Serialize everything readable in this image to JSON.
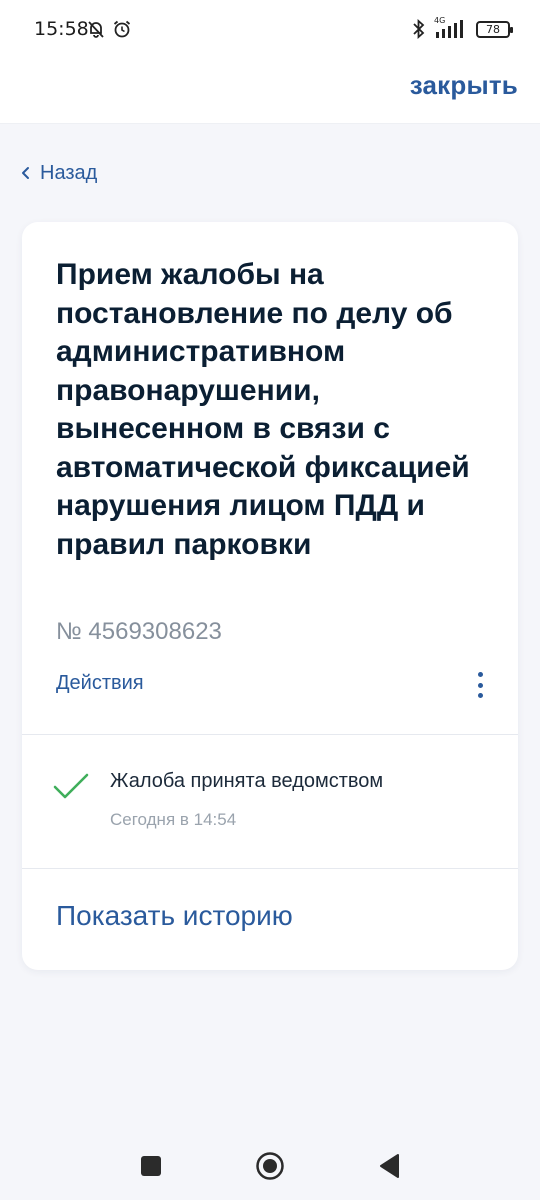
{
  "status_bar": {
    "time": "15:58",
    "network": "4G",
    "battery": "78",
    "icons": [
      "muted-bell-icon",
      "alarm-icon",
      "bluetooth-icon",
      "signal-icon",
      "battery-icon"
    ]
  },
  "header": {
    "close_label": "закрыть"
  },
  "back": {
    "label": "Назад"
  },
  "card": {
    "title": "Прием жалобы на постановление по делу об административном правонарушении, вынесенном в связи с автоматической фиксацией нарушения лицом ПДД и правил парковки",
    "number": "№ 4569308623",
    "actions_label": "Действия",
    "status": {
      "text": "Жалоба принята ведомством",
      "time": "Сегодня в 14:54",
      "color": "#3fae5b"
    },
    "history_label": "Показать историю"
  },
  "colors": {
    "accent": "#2a5a9c",
    "background": "#f5f6fa",
    "card": "#ffffff"
  }
}
